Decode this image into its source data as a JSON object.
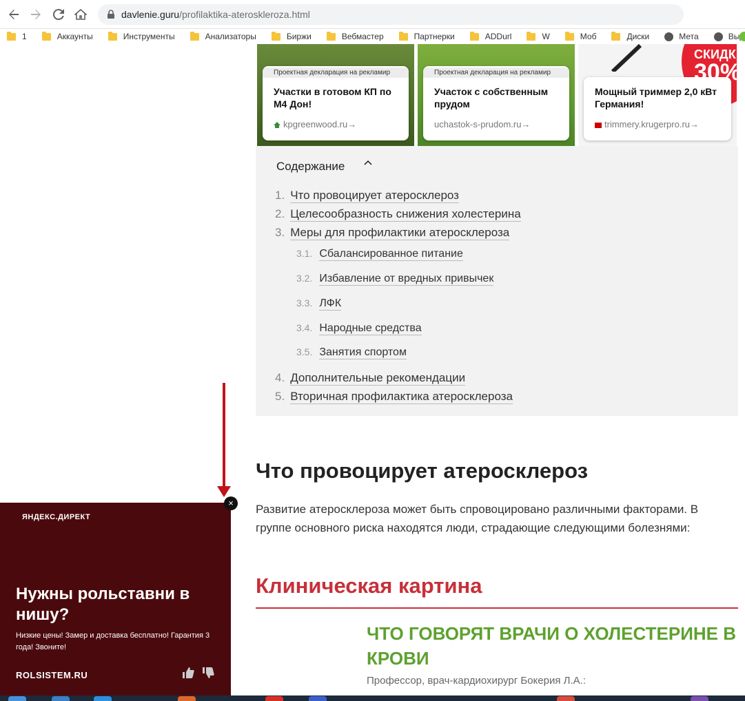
{
  "browser": {
    "url_host": "davlenie.guru",
    "url_path": "/profilaktika-ateroskleroza.html",
    "bookmarks": [
      "1",
      "Аккаунты",
      "Инструменты",
      "Анализаторы",
      "Биржи",
      "Вебмастер",
      "Партнерки",
      "ADDurl",
      "W",
      "Моб",
      "Диски",
      "Мета",
      "Выдача"
    ]
  },
  "ads": [
    {
      "decl": "Проектная декларация на рекламир",
      "title": "Участки в готовом КП по М4 Дон!",
      "domain": "kpgreenwood.ru",
      "arrow": "→"
    },
    {
      "decl": "Проектная декларация на рекламир",
      "title": "Участок с собственным прудом",
      "domain": "uchastok-s-prudom.ru",
      "arrow": "→"
    },
    {
      "decl": "",
      "title": "Мощный триммер 2,0 кВт Германия!",
      "domain": "trimmery.krugerpro.ru",
      "arrow": "→",
      "badge_top": "СКИДК",
      "badge_pct": "30%"
    }
  ],
  "toc": {
    "title": "Содержание",
    "chevron": "^",
    "items": [
      {
        "num": "1.",
        "label": "Что провоцирует атеросклероз"
      },
      {
        "num": "2.",
        "label": "Целесообразность снижения холестерина"
      },
      {
        "num": "3.",
        "label": "Меры для профилактики атеросклероза"
      },
      {
        "num": "3.1.",
        "label": "Сбалансированное питание"
      },
      {
        "num": "3.2.",
        "label": "Избавление от вредных привычек"
      },
      {
        "num": "3.3.",
        "label": "ЛФК"
      },
      {
        "num": "3.4.",
        "label": "Народные средства"
      },
      {
        "num": "3.5.",
        "label": "Занятия спортом"
      },
      {
        "num": "4.",
        "label": "Дополнительные рекомендации"
      },
      {
        "num": "5.",
        "label": "Вторичная профилактика атеросклероза"
      }
    ]
  },
  "article": {
    "heading": "Что провоцирует атеросклероз",
    "paragraph": "Развитие атеросклероза может быть спровоцировано различными факторами. В группе основного риска находятся люди, страдающие следующими болезнями:",
    "red_heading": "Клиническая картина",
    "green_heading": "ЧТО ГОВОРЯТ ВРАЧИ О ХОЛЕСТЕРИНЕ В КРОВИ",
    "professor": "Профессор, врач-кардиохирург Бокерия Л.А.:"
  },
  "popup": {
    "brand": "ЯНДЕКС.ДИРЕКТ",
    "title": "Нужны рольставни в нишу?",
    "text": "Низкие цены! Замер и доставка бесплатно! Гарантия 3 года! Звоните!",
    "domain": "ROLSISTEM.RU",
    "close": "×"
  },
  "colors": {
    "accent_red": "#c7303a",
    "green": "#5da12f",
    "popup_bg": "#4a0a0d"
  }
}
